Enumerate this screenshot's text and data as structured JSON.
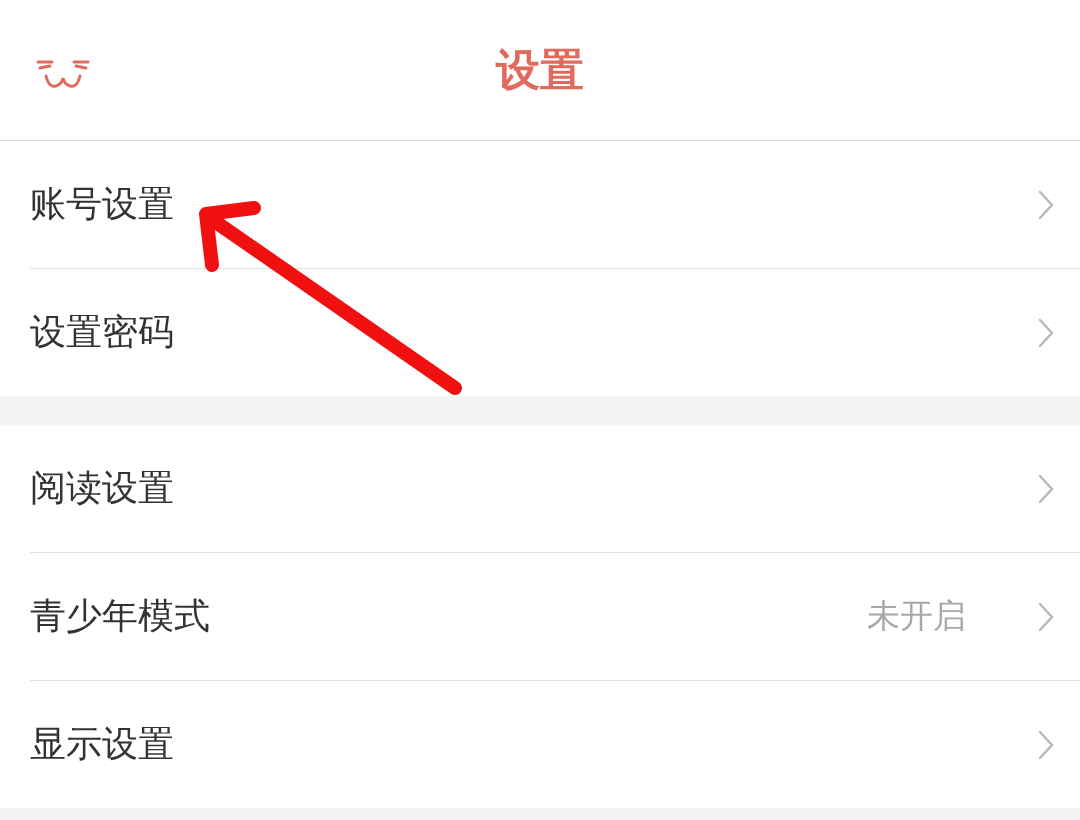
{
  "header": {
    "title": "设置"
  },
  "groups": [
    {
      "rows": [
        {
          "label": "账号设置"
        },
        {
          "label": "设置密码"
        }
      ]
    },
    {
      "rows": [
        {
          "label": "阅读设置"
        },
        {
          "label": "青少年模式",
          "value": "未开启"
        },
        {
          "label": "显示设置"
        }
      ]
    }
  ]
}
